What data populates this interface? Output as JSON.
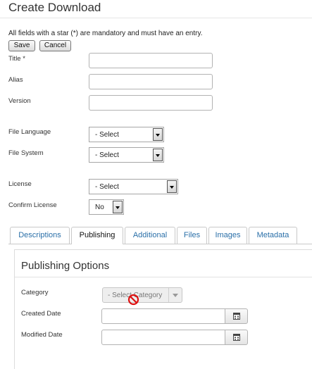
{
  "header": {
    "title": "Create Download"
  },
  "form": {
    "notice": "All fields with a star (*) are mandatory and must have an entry.",
    "buttons": {
      "save": "Save",
      "cancel": "Cancel"
    },
    "fields": {
      "title": {
        "label": "Title *",
        "value": ""
      },
      "alias": {
        "label": "Alias",
        "value": ""
      },
      "version": {
        "label": "Version",
        "value": ""
      },
      "file_language": {
        "label": "File Language",
        "selected": "- Select"
      },
      "file_system": {
        "label": "File System",
        "selected": "- Select"
      },
      "license": {
        "label": "License",
        "selected": "- Select"
      },
      "confirm_license": {
        "label": "Confirm License",
        "selected": "No"
      }
    }
  },
  "tabs": [
    {
      "label": "Descriptions",
      "active": false
    },
    {
      "label": "Publishing",
      "active": true
    },
    {
      "label": "Additional",
      "active": false
    },
    {
      "label": "Files",
      "active": false
    },
    {
      "label": "Images",
      "active": false
    },
    {
      "label": "Metadata",
      "active": false
    }
  ],
  "publishing": {
    "heading": "Publishing Options",
    "category": {
      "label": "Category",
      "selected": "- Select Category",
      "disabled": true,
      "cursor": "not-allowed"
    },
    "created_date": {
      "label": "Created Date",
      "value": ""
    },
    "modified_date": {
      "label": "Modified Date",
      "value": ""
    },
    "calendar_icon": "calendar-icon"
  },
  "colors": {
    "tab_link": "#2a6fa8",
    "border": "#b3b3b3",
    "cursor_red": "#dd1111"
  }
}
